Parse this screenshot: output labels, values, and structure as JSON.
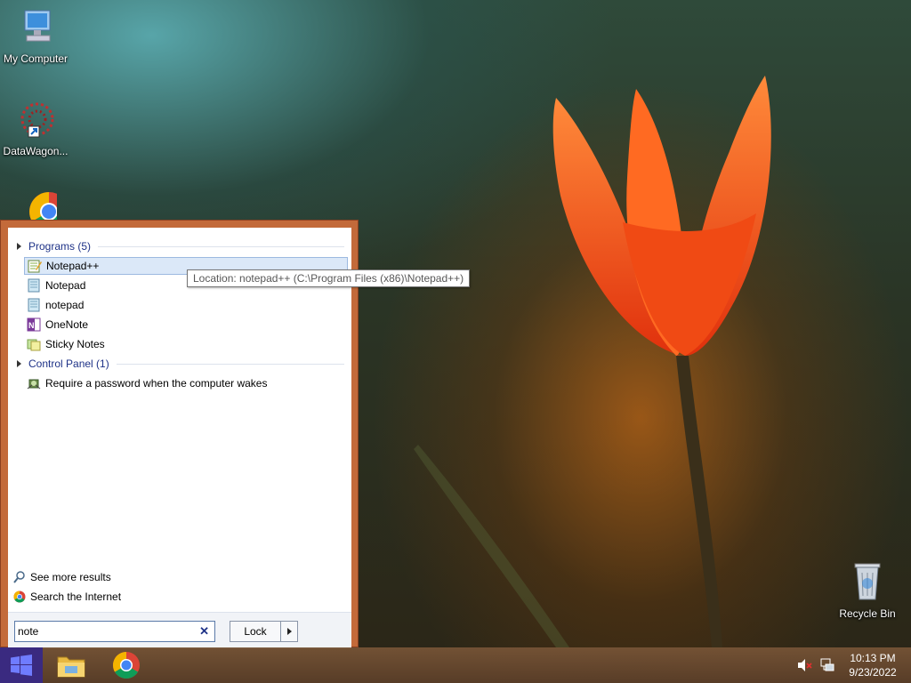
{
  "desktop": {
    "icons": [
      {
        "label": "My Computer"
      },
      {
        "label": "DataWagon..."
      },
      {
        "label": "Recycle Bin"
      }
    ]
  },
  "start_menu": {
    "programs_header": "Programs (5)",
    "programs": [
      {
        "label": "Notepad++",
        "icon": "notepadpp-icon",
        "selected": true
      },
      {
        "label": "Notepad",
        "icon": "notepad-icon"
      },
      {
        "label": "notepad",
        "icon": "notepad-icon"
      },
      {
        "label": "OneNote",
        "icon": "onenote-icon"
      },
      {
        "label": "Sticky Notes",
        "icon": "sticky-notes-icon"
      }
    ],
    "control_panel_header": "Control Panel (1)",
    "control_panel_items": [
      {
        "label": "Require a password when the computer wakes",
        "icon": "power-options-icon"
      }
    ],
    "tooltip": "Location: notepad++ (C:\\Program Files (x86)\\Notepad++)",
    "see_more_results": "See more results",
    "search_internet": "Search the Internet",
    "search": {
      "value": "note",
      "clear_icon": "close-icon"
    },
    "lock_button": "Lock"
  },
  "taskbar": {
    "apps": [
      "file-explorer-icon",
      "chrome-icon"
    ],
    "tray": {
      "volume": "muted",
      "network": "network-icon"
    },
    "time": "10:13 PM",
    "date": "9/23/2022"
  }
}
